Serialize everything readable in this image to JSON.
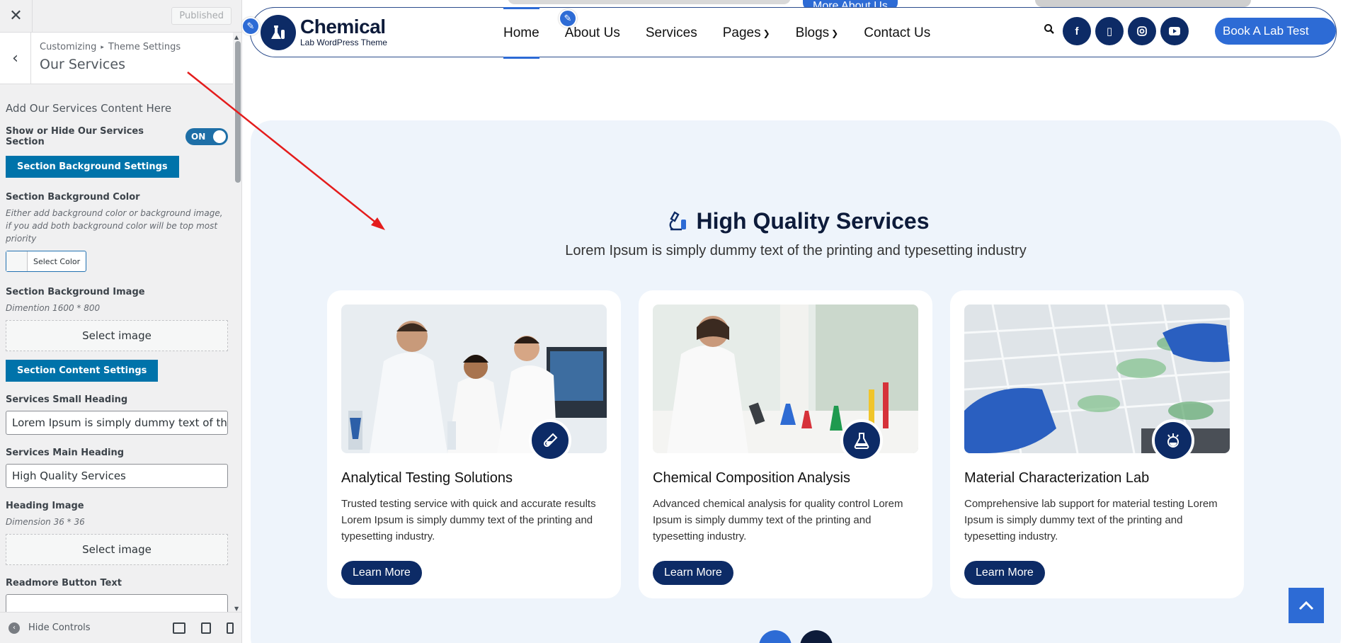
{
  "customizer": {
    "close_icon": "close-icon",
    "published_label": "Published",
    "breadcrumb": [
      "Customizing",
      "Theme Settings"
    ],
    "title": "Our Services",
    "section_intro": "Add Our Services Content Here",
    "show_hide_label": "Show or Hide Our Services Section",
    "toggle_state": "ON",
    "bg_settings_button": "Section Background Settings",
    "bg_color_label": "Section Background Color",
    "bg_color_desc": "Either add background color or background image, if you add both background color will be top most priority",
    "select_color_label": "Select Color",
    "bg_image_label": "Section Background Image",
    "bg_image_desc": "Dimention 1600 * 800",
    "select_image_label": "Select image",
    "content_settings_button": "Section Content Settings",
    "small_heading_label": "Services Small Heading",
    "small_heading_value": "Lorem Ipsum is simply dummy text of the",
    "main_heading_label": "Services Main Heading",
    "main_heading_value": "High Quality Services",
    "heading_image_label": "Heading Image",
    "heading_image_desc": "Dimension 36 * 36",
    "select_image_label_2": "Select image",
    "readmore_label": "Readmore Button Text",
    "hide_controls_label": "Hide Controls"
  },
  "site": {
    "hero_more_label": "More About Us",
    "logo_name": "Chemical",
    "logo_tagline": "Lab WordPress Theme",
    "nav": [
      {
        "label": "Home",
        "active": true,
        "dropdown": false
      },
      {
        "label": "About Us",
        "active": false,
        "dropdown": false
      },
      {
        "label": "Services",
        "active": false,
        "dropdown": false
      },
      {
        "label": "Pages",
        "active": false,
        "dropdown": true
      },
      {
        "label": "Blogs",
        "active": false,
        "dropdown": true
      },
      {
        "label": "Contact Us",
        "active": false,
        "dropdown": false
      }
    ],
    "socials": [
      "facebook-icon",
      "tiktok-icon",
      "instagram-icon",
      "youtube-icon"
    ],
    "book_button": "Book A Lab Test",
    "accent_color": "#2d6bd5",
    "navy_color": "#0d2b66"
  },
  "services": {
    "heading": "High Quality Services",
    "subheading": "Lorem Ipsum is simply dummy text of the printing and typesetting industry",
    "cards": [
      {
        "title": "Analytical Testing Solutions",
        "text": "Trusted testing service with quick and accurate results Lorem Ipsum is simply dummy text of the printing and typesetting industry.",
        "button": "Learn More",
        "badge_icon": "test-tube-icon"
      },
      {
        "title": "Chemical Composition Analysis",
        "text": "Advanced chemical analysis for quality control Lorem Ipsum is simply dummy text of the printing and typesetting industry.",
        "button": "Learn More",
        "badge_icon": "flask-icon"
      },
      {
        "title": "Material Characterization Lab",
        "text": "Comprehensive lab support for material testing Lorem Ipsum is simply dummy text of the printing and typesetting industry.",
        "button": "Learn More",
        "badge_icon": "lab-bulb-icon"
      }
    ]
  }
}
